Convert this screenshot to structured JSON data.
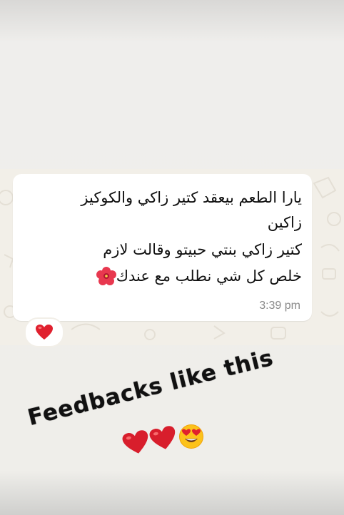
{
  "message": {
    "lines": [
      "يارا الطعم بيعقد كتير زاكي والكوكيز",
      "زاكين",
      "كتير زاكي بنتي حبيتو وقالت لازم",
      "خلص كل شي نطلب مع عندك"
    ],
    "trailing_emoji": "hibiscus-icon",
    "timestamp": "3:39 pm",
    "reaction": "red-heart-icon"
  },
  "overlay": {
    "caption": "Feedbacks like this",
    "emojis": [
      "red-heart-icon",
      "red-heart-icon",
      "heart-eyes-face-icon"
    ]
  },
  "colors": {
    "bubble": "#ffffff",
    "wallpaper": "#f2efe8",
    "text": "#111111",
    "timestamp": "#8a8a8a",
    "heart": "#e0202e"
  }
}
